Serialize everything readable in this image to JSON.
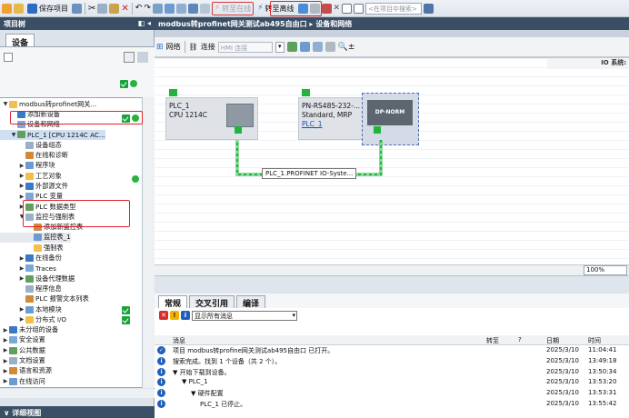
{
  "toolbar": {
    "save_project": "保存项目",
    "go_online": "转至在线",
    "go_offline": "转至离线",
    "search_placeholder": "<在项目中搜索>"
  },
  "left": {
    "panel_title": "项目树",
    "tab_devices": "设备",
    "detail_view": "详细视图",
    "tree": [
      {
        "label": "modbus转profinet网关...",
        "level": 0,
        "expanded": "▼"
      },
      {
        "label": "添加新设备",
        "level": 1
      },
      {
        "label": "设备和网络",
        "level": 1
      },
      {
        "label": "PLC_1 [CPU 1214C AC...",
        "level": 1,
        "expanded": "▼"
      },
      {
        "label": "设备组态",
        "level": 2
      },
      {
        "label": "在线和诊断",
        "level": 2
      },
      {
        "label": "程序块",
        "level": 2,
        "expanded": "▶"
      },
      {
        "label": "工艺对象",
        "level": 2,
        "expanded": "▶"
      },
      {
        "label": "外部源文件",
        "level": 2,
        "expanded": "▶"
      },
      {
        "label": "PLC 变量",
        "level": 2,
        "expanded": "▶"
      },
      {
        "label": "PLC 数据类型",
        "level": 2,
        "expanded": "▶"
      },
      {
        "label": "监控与强制表",
        "level": 2,
        "expanded": "▼"
      },
      {
        "label": "添加新监控表",
        "level": 3
      },
      {
        "label": "监控表_1",
        "level": 3
      },
      {
        "label": "强制表",
        "level": 3
      },
      {
        "label": "在线备份",
        "level": 2,
        "expanded": "▶"
      },
      {
        "label": "Traces",
        "level": 2,
        "expanded": "▶"
      },
      {
        "label": "设备代理数据",
        "level": 2,
        "expanded": "▶"
      },
      {
        "label": "程序信息",
        "level": 2
      },
      {
        "label": "PLC 报警文本列表",
        "level": 2
      },
      {
        "label": "本地模块",
        "level": 2,
        "expanded": "▶"
      },
      {
        "label": "分布式 I/O",
        "level": 2,
        "expanded": "▶"
      },
      {
        "label": "未分组的设备",
        "level": 0,
        "expanded": "▶"
      },
      {
        "label": "安全设置",
        "level": 0,
        "expanded": "▶"
      },
      {
        "label": "公共数据",
        "level": 0,
        "expanded": "▶"
      },
      {
        "label": "文档设置",
        "level": 0,
        "expanded": "▶"
      },
      {
        "label": "语言和资源",
        "level": 0,
        "expanded": "▶"
      },
      {
        "label": "在线访问",
        "level": 0,
        "expanded": "▶"
      }
    ]
  },
  "main": {
    "header": "modbus转profinet网关测试ab495自由口 ▸ 设备和网络",
    "net_tools": {
      "network": "网络",
      "connections": "连接",
      "hmi_select": "HMI 连接"
    },
    "io_system": "IO 系统:",
    "devices": {
      "plc": {
        "name": "PLC_1",
        "type": "CPU 1214C"
      },
      "pn": {
        "name": "PN-RS485-232-...",
        "type": "Standard, MRP",
        "link": "PLC_1",
        "badge": "DP-NORM"
      }
    },
    "profinet_label": "PLC_1.PROFINET IO-Syste...",
    "zoom": "100%"
  },
  "props": {
    "tabs": [
      "常规",
      "交叉引用",
      "编译"
    ],
    "filter": "显示所有消息",
    "columns": {
      "msg": "消息",
      "goto": "转至",
      "q": "?",
      "date": "日期",
      "time": "时间"
    },
    "rows": [
      {
        "text": "项目 modbus转profine网关测试ab495自由口 已打开。",
        "indent": 0,
        "date": "2025/3/10",
        "time": "11:04:41",
        "status": "ok"
      },
      {
        "text": "搜索完成。找到 1 个设备（共 2 个）。",
        "indent": 0,
        "date": "2025/3/10",
        "time": "13:49:18",
        "status": "info"
      },
      {
        "text": "▼ 开始下载到设备。",
        "indent": 0,
        "date": "2025/3/10",
        "time": "13:50:34",
        "status": "info"
      },
      {
        "text": "▼ PLC_1",
        "indent": 1,
        "date": "2025/3/10",
        "time": "13:53:20",
        "status": "info"
      },
      {
        "text": "▼ 硬件配置",
        "indent": 2,
        "date": "2025/3/10",
        "time": "13:53:31",
        "status": "info"
      },
      {
        "text": "PLC_1 已停止。",
        "indent": 3,
        "date": "2025/3/10",
        "time": "13:55:42",
        "status": "info"
      }
    ]
  },
  "colors": {
    "accent_dark": "#3a4f66",
    "status_green": "#21b33e",
    "highlight_red": "#e0242c"
  }
}
